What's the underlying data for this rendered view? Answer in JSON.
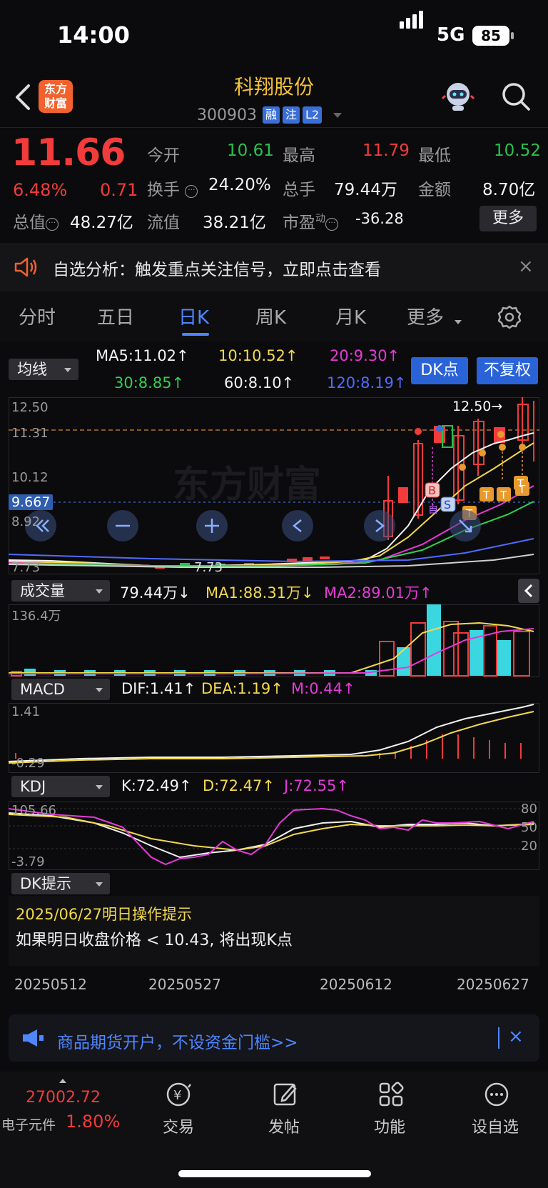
{
  "status": {
    "time": "14:00",
    "network": "5G",
    "battery": "85"
  },
  "header": {
    "logo_line1": "东方",
    "logo_line2": "财富",
    "name": "科翔股份",
    "code": "300903",
    "badges": [
      "融",
      "注",
      "L2"
    ]
  },
  "quote": {
    "price": "11.66",
    "pct": "6.48%",
    "chg": "0.71",
    "open_label": "今开",
    "open": "10.61",
    "high_label": "最高",
    "high": "11.79",
    "low_label": "最低",
    "low": "10.52",
    "turnover_label": "换手",
    "turnover": "24.20%",
    "volume_label": "总手",
    "volume": "79.44万",
    "amount_label": "金额",
    "amount": "8.70亿",
    "mcap_label": "总值",
    "mcap": "48.27亿",
    "float_label": "流值",
    "float": "38.21亿",
    "pe_label": "市盈",
    "pe_sup": "动",
    "pe": "-36.28",
    "more": "更多"
  },
  "alert": {
    "text": "自选分析：触发重点关注信号，立即点击查看",
    "close": "×"
  },
  "tabs": [
    {
      "label": "分时"
    },
    {
      "label": "五日"
    },
    {
      "label": "日K"
    },
    {
      "label": "周K"
    },
    {
      "label": "月K"
    },
    {
      "label": "更多"
    }
  ],
  "ma_row": {
    "selector": "均线",
    "ma5": "MA5:11.02↑",
    "ma10": "10:10.52↑",
    "ma20": "20:9.30↑",
    "ma30": "30:8.85↑",
    "ma60": "60:8.10↑",
    "ma120": "120:8.19↑",
    "dk_button": "DK点",
    "fq_button": "不复权"
  },
  "kline": {
    "y_top": "12.50",
    "y_1131": "11.31",
    "y_1012": "10.12",
    "y_9667": "9.667",
    "y_892": "8.92",
    "y_low": "7.73",
    "low_mark": "7.73",
    "high_mark": "12.50→"
  },
  "vol_row": {
    "selector": "成交量",
    "val": "79.44万↓",
    "ma1": "MA1:88.31万↓",
    "ma2": "MA2:89.01万↑",
    "y_top": "136.4万"
  },
  "macd_row": {
    "selector": "MACD",
    "dif": "DIF:1.41↑",
    "dea": "DEA:1.19↑",
    "m": "M:0.44↑",
    "y_top": "1.41",
    "y_bot": "-0.29"
  },
  "kdj_row": {
    "selector": "KDJ",
    "k": "K:72.49↑",
    "d": "D:72.47↑",
    "j": "J:72.55↑",
    "y_top": "105.66",
    "y_bot": "-3.79",
    "r80": "80",
    "r50": "50",
    "r20": "20"
  },
  "dk_hint": {
    "selector": "DK提示",
    "date": "2025/06/27明日操作提示",
    "text": "如果明日收盘价格 < 10.43, 将出现K点"
  },
  "dates": [
    "20250512",
    "20250527",
    "20250612",
    "20250627"
  ],
  "ad": {
    "text": "商品期货开户，不设资金门槛>>",
    "close": "×"
  },
  "bottom": {
    "index_value": "27002.72",
    "index_name": "电子元件",
    "index_pct": "1.80%",
    "nav": [
      {
        "label": "交易"
      },
      {
        "label": "发帖"
      },
      {
        "label": "功能"
      },
      {
        "label": "设自选"
      }
    ]
  },
  "colors": {
    "up": "#f23b3b",
    "down": "#27c24c",
    "accent": "#4f86ff",
    "title": "#f2c13a"
  }
}
